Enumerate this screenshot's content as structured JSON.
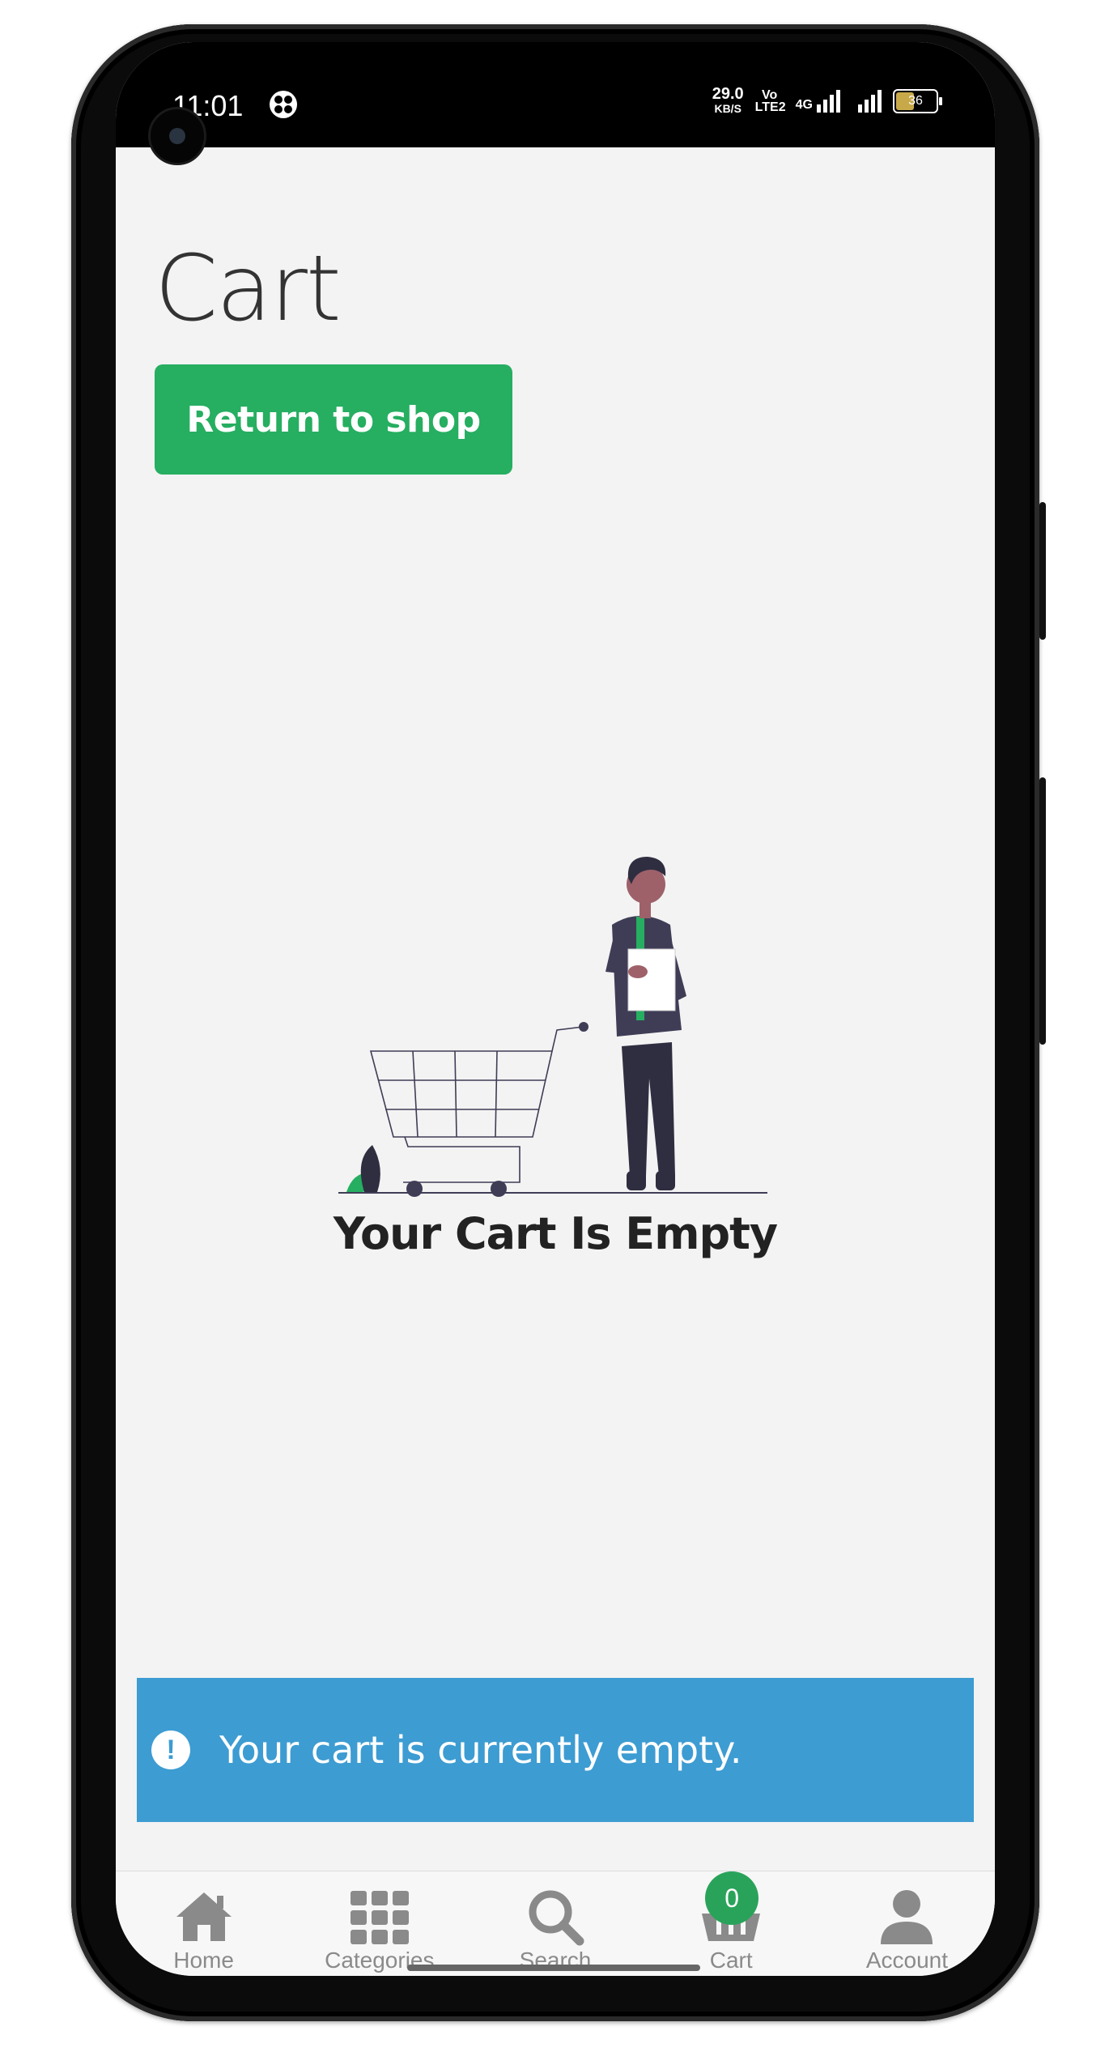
{
  "statusbar": {
    "time": "11:01",
    "speed_value": "29.0",
    "speed_unit": "KB/S",
    "volte": "Vo LTE2",
    "network": "4G",
    "battery": "36"
  },
  "page": {
    "title": "Cart",
    "return_button": "Return to shop",
    "empty_title": "Your Cart Is Empty",
    "notice": "Your cart is currently empty.",
    "notice_icon": "!"
  },
  "tabbar": {
    "items": [
      {
        "label": "Home",
        "icon": "home-icon"
      },
      {
        "label": "Categories",
        "icon": "grid-icon"
      },
      {
        "label": "Search",
        "icon": "search-icon"
      },
      {
        "label": "Cart",
        "icon": "cart-icon",
        "badge": "0"
      },
      {
        "label": "Account",
        "icon": "user-icon"
      }
    ]
  },
  "colors": {
    "accent_green": "#26ae61",
    "notice_blue": "#3d9cd2",
    "badge_green": "#2aa35a",
    "tab_icon_gray": "#888888"
  }
}
